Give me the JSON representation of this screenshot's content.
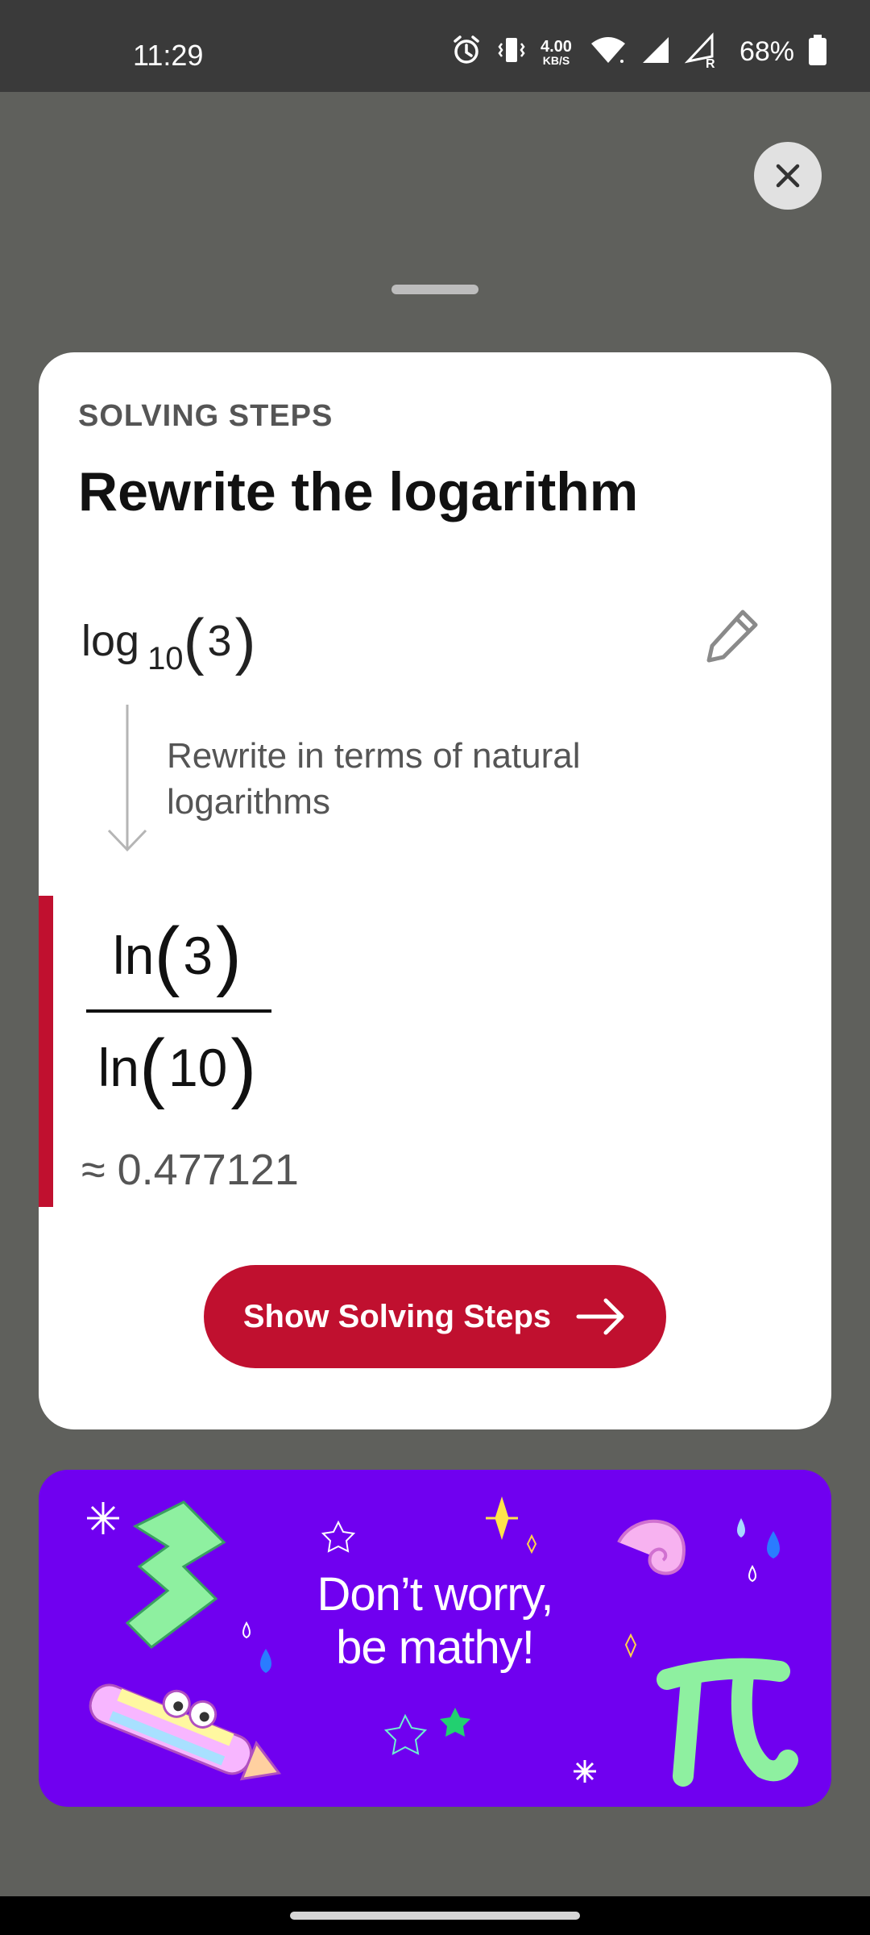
{
  "status_bar": {
    "time": "11:29",
    "net_speed_value": "4.00",
    "net_speed_unit": "KB/S",
    "battery": "68%",
    "icons": [
      "alarm-icon",
      "vibrate-icon",
      "wifi-icon",
      "signal-icon",
      "signal-roaming-icon",
      "battery-icon"
    ]
  },
  "sheet": {
    "close_icon": "close-icon",
    "eyebrow": "SOLVING STEPS",
    "title": "Rewrite the logarithm",
    "expression": {
      "fn": "log",
      "base": "10",
      "open": "(",
      "arg": "3",
      "close": ")"
    },
    "edit_icon": "pencil-icon",
    "step_description": "Rewrite in terms of natural logarithms",
    "result": {
      "numerator": {
        "fn": "ln",
        "open": "(",
        "arg": "3",
        "close": ")"
      },
      "denominator": {
        "fn": "ln",
        "open": "(",
        "arg": "10",
        "close": ")"
      },
      "approximation": "≈ 0.477121"
    },
    "cta_label": "Show Solving Steps",
    "cta_icon": "arrow-right-icon",
    "accent_color": "#c0102f"
  },
  "banner": {
    "line1": "Don’t worry,",
    "line2": "be mathy!",
    "background_color": "#7000f0"
  }
}
